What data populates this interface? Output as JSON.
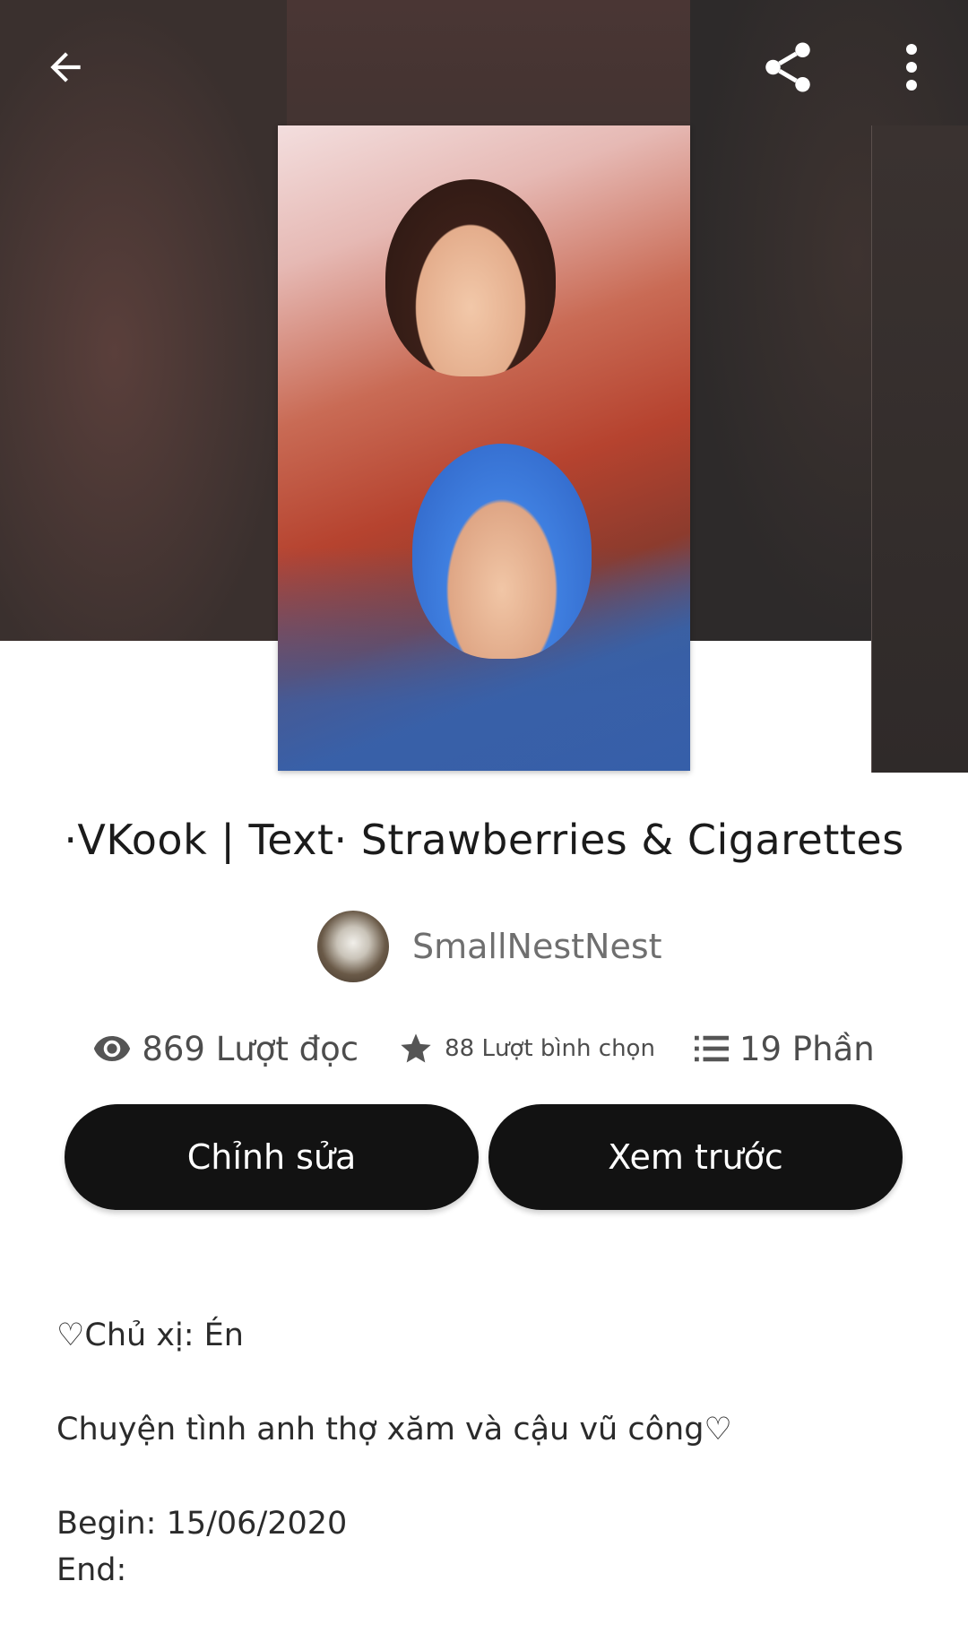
{
  "header": {
    "back_icon": "arrow-left-icon",
    "share_icon": "share-icon",
    "more_icon": "more-vertical-icon"
  },
  "story": {
    "title": "·VKook | Text· Strawberries & Cigarettes",
    "author": "SmallNestNest"
  },
  "stats": {
    "reads": "869 Lượt đọc",
    "votes": "88 Lượt bình chọn",
    "parts": "19 Phần"
  },
  "buttons": {
    "edit": "Chỉnh sửa",
    "preview": "Xem trước"
  },
  "description": {
    "line1": "♡Chủ xị: Én",
    "line2": "Chuyện tình anh thợ xăm và cậu vũ công♡",
    "begin": "Begin: 15/06/2020",
    "end": "End:"
  }
}
